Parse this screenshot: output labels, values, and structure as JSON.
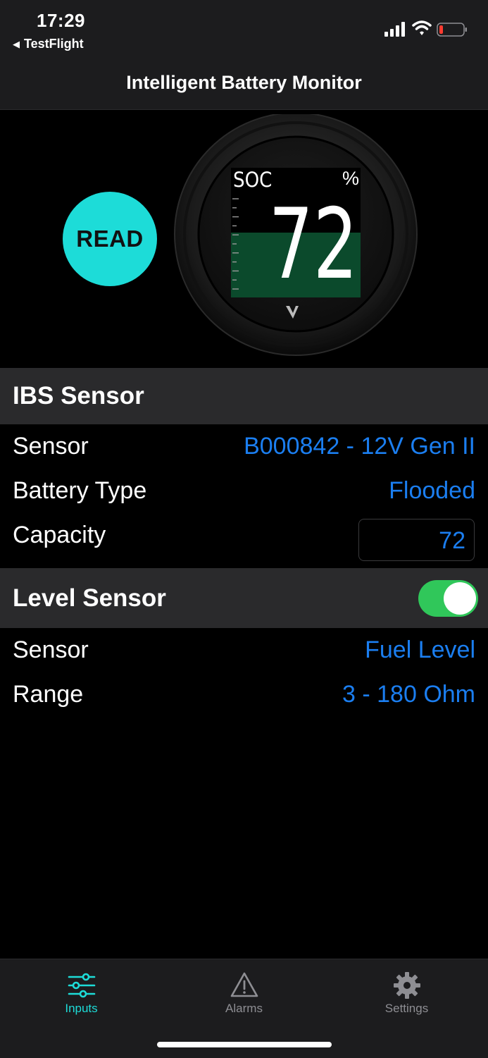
{
  "status_bar": {
    "time": "17:29",
    "back_app": "TestFlight"
  },
  "nav": {
    "title": "Intelligent Battery Monitor"
  },
  "gauge": {
    "read_label": "READ",
    "soc_label": "SOC",
    "unit": "%",
    "value": "72",
    "fill_fraction": 0.5
  },
  "ibs_section": {
    "title": "IBS Sensor",
    "rows": [
      {
        "label": "Sensor",
        "value": "B000842 - 12V Gen II"
      },
      {
        "label": "Battery Type",
        "value": "Flooded"
      },
      {
        "label": "Capacity",
        "value": "72"
      }
    ]
  },
  "level_section": {
    "title": "Level Sensor",
    "enabled": true,
    "rows": [
      {
        "label": "Sensor",
        "value": "Fuel Level"
      },
      {
        "label": "Range",
        "value": "3 - 180 Ohm"
      }
    ]
  },
  "tabs": [
    {
      "label": "Inputs",
      "icon": "sliders-icon",
      "active": true
    },
    {
      "label": "Alarms",
      "icon": "warning-icon",
      "active": false
    },
    {
      "label": "Settings",
      "icon": "gear-icon",
      "active": false
    }
  ],
  "colors": {
    "accent": "#1ddcd8",
    "link": "#1b7ef0",
    "toggle_on": "#30c75a",
    "gauge_fill": "#0b4a2c"
  }
}
